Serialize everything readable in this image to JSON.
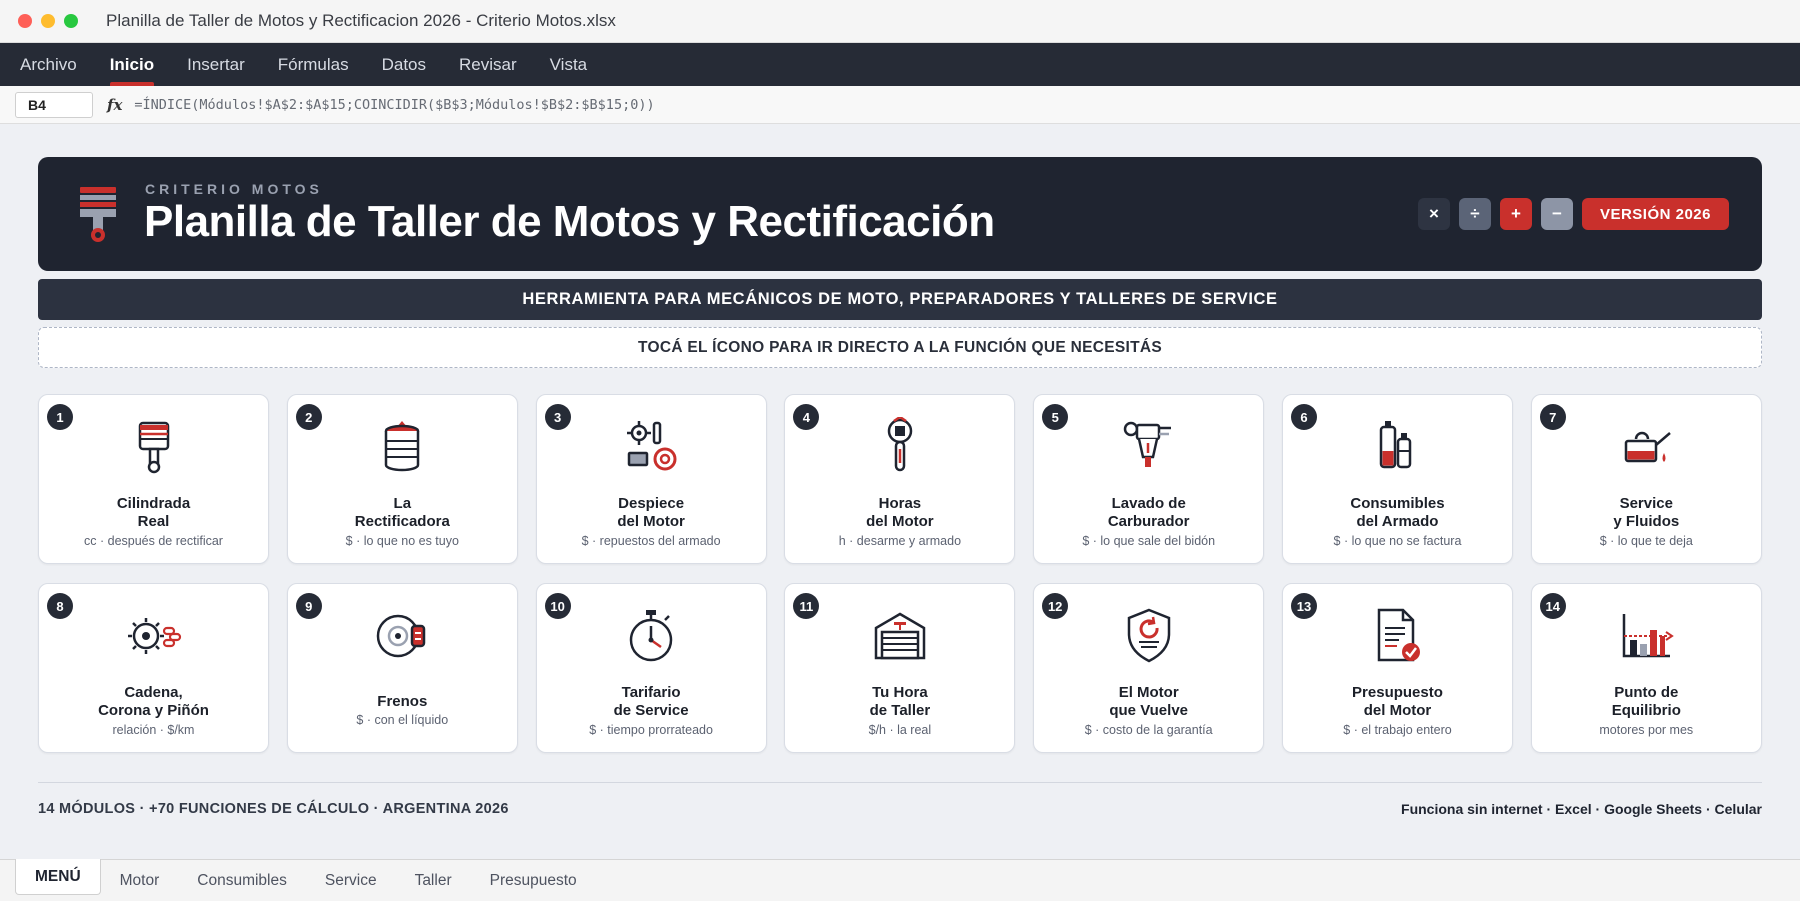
{
  "window": {
    "title": "Planilla de Taller de Motos y Rectificacion 2026 - Criterio Motos.xlsx"
  },
  "ribbon": {
    "tabs": [
      "Archivo",
      "Inicio",
      "Insertar",
      "Fórmulas",
      "Datos",
      "Revisar",
      "Vista"
    ],
    "active": "Inicio"
  },
  "formula_bar": {
    "cell": "B4",
    "fx": "fx",
    "formula": "=ÍNDICE(Módulos!$A$2:$A$15;COINCIDIR($B$3;Módulos!$B$2:$B$15;0))"
  },
  "hero": {
    "brand": "CRITERIO MOTOS",
    "title": "Planilla de Taller de Motos y Rectificación",
    "ops": [
      "×",
      "÷",
      "+",
      "−"
    ],
    "version": "VERSIÓN 2026"
  },
  "banner": "HERRAMIENTA PARA MECÁNICOS DE MOTO, PREPARADORES Y TALLERES DE SERVICE",
  "hint": "TOCÁ EL ÍCONO PARA IR DIRECTO A LA FUNCIÓN QUE NECESITÁS",
  "modules": [
    {
      "num": "1",
      "title": "Cilindrada\nReal",
      "sub": "cc · después de rectificar",
      "icon": "piston-icon"
    },
    {
      "num": "2",
      "title": "La\nRectificadora",
      "sub": "$ · lo que no es tuyo",
      "icon": "cylinder-icon"
    },
    {
      "num": "3",
      "title": "Despiece\ndel Motor",
      "sub": "$ · repuestos del armado",
      "icon": "engine-parts-icon"
    },
    {
      "num": "4",
      "title": "Horas\ndel Motor",
      "sub": "h · desarme y armado",
      "icon": "wrench-icon"
    },
    {
      "num": "5",
      "title": "Lavado de\nCarburador",
      "sub": "$ · lo que sale del bidón",
      "icon": "carburetor-icon"
    },
    {
      "num": "6",
      "title": "Consumibles\ndel Armado",
      "sub": "$ · lo que no se factura",
      "icon": "bottles-icon"
    },
    {
      "num": "7",
      "title": "Service\ny Fluidos",
      "sub": "$ · lo que te deja",
      "icon": "oil-can-icon"
    },
    {
      "num": "8",
      "title": "Cadena,\nCorona y Piñón",
      "sub": "relación · $/km",
      "icon": "sprocket-icon"
    },
    {
      "num": "9",
      "title": "Frenos",
      "sub": "$ · con el líquido",
      "icon": "brake-disc-icon"
    },
    {
      "num": "10",
      "title": "Tarifario\nde Service",
      "sub": "$ · tiempo prorrateado",
      "icon": "stopwatch-icon"
    },
    {
      "num": "11",
      "title": "Tu Hora\nde Taller",
      "sub": "$/h · la real",
      "icon": "garage-icon"
    },
    {
      "num": "12",
      "title": "El Motor\nque Vuelve",
      "sub": "$ · costo de la garantía",
      "icon": "warranty-shield-icon"
    },
    {
      "num": "13",
      "title": "Presupuesto\ndel Motor",
      "sub": "$ · el trabajo entero",
      "icon": "invoice-icon"
    },
    {
      "num": "14",
      "title": "Punto de\nEquilibrio",
      "sub": "motores por mes",
      "icon": "break-even-chart-icon"
    }
  ],
  "footer": {
    "left": "14 MÓDULOS · +70 FUNCIONES DE CÁLCULO · ARGENTINA 2026",
    "right": "Funciona sin internet · Excel · Google Sheets · Celular"
  },
  "sheet_tabs": [
    "MENÚ",
    "Motor",
    "Consumibles",
    "Service",
    "Taller",
    "Presupuesto"
  ],
  "colors": {
    "dark": "#1f2430",
    "accent": "#c9302c",
    "sheet_bg": "#eef0f4"
  }
}
